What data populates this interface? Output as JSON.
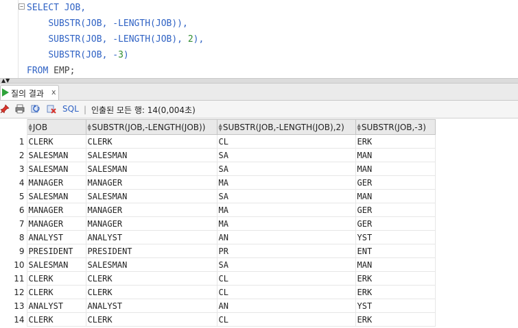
{
  "editor": {
    "line1_kw": "SELECT",
    "line1_rest": " JOB,",
    "line2_fn": "SUBSTR",
    "line2_a": "(JOB, -",
    "line2_fn2": "LENGTH",
    "line2_b": "(JOB)),",
    "line3_fn": "SUBSTR",
    "line3_a": "(JOB, -",
    "line3_fn2": "LENGTH",
    "line3_b": "(JOB), ",
    "line3_num": "2",
    "line3_c": "),",
    "line4_fn": "SUBSTR",
    "line4_a": "(JOB, -",
    "line4_num": "3",
    "line4_c": ")",
    "line5_kw": "FROM",
    "line5_rest": " EMP;"
  },
  "results_tab": {
    "label": "질의 결과",
    "close": "x"
  },
  "toolbar": {
    "sql_label": "SQL",
    "separator": "|",
    "status": "인출된 모든 행: 14(0,004초)"
  },
  "icons": [
    "pin-icon",
    "print-icon",
    "refresh-icon",
    "export-icon",
    "play-icon",
    "sort-icon"
  ],
  "table": {
    "columns": [
      "JOB",
      "SUBSTR(JOB,-LENGTH(JOB))",
      "SUBSTR(JOB,-LENGTH(JOB),2)",
      "SUBSTR(JOB,-3)"
    ],
    "rows": [
      [
        "1",
        "CLERK",
        "CLERK",
        "CL",
        "ERK"
      ],
      [
        "2",
        "SALESMAN",
        "SALESMAN",
        "SA",
        "MAN"
      ],
      [
        "3",
        "SALESMAN",
        "SALESMAN",
        "SA",
        "MAN"
      ],
      [
        "4",
        "MANAGER",
        "MANAGER",
        "MA",
        "GER"
      ],
      [
        "5",
        "SALESMAN",
        "SALESMAN",
        "SA",
        "MAN"
      ],
      [
        "6",
        "MANAGER",
        "MANAGER",
        "MA",
        "GER"
      ],
      [
        "7",
        "MANAGER",
        "MANAGER",
        "MA",
        "GER"
      ],
      [
        "8",
        "ANALYST",
        "ANALYST",
        "AN",
        "YST"
      ],
      [
        "9",
        "PRESIDENT",
        "PRESIDENT",
        "PR",
        "ENT"
      ],
      [
        "10",
        "SALESMAN",
        "SALESMAN",
        "SA",
        "MAN"
      ],
      [
        "11",
        "CLERK",
        "CLERK",
        "CL",
        "ERK"
      ],
      [
        "12",
        "CLERK",
        "CLERK",
        "CL",
        "ERK"
      ],
      [
        "13",
        "ANALYST",
        "ANALYST",
        "AN",
        "YST"
      ],
      [
        "14",
        "CLERK",
        "CLERK",
        "CL",
        "ERK"
      ]
    ]
  },
  "colors": {
    "keyword": "#2f62c4",
    "number": "#2e8b2e",
    "run": "#2fa33a"
  }
}
